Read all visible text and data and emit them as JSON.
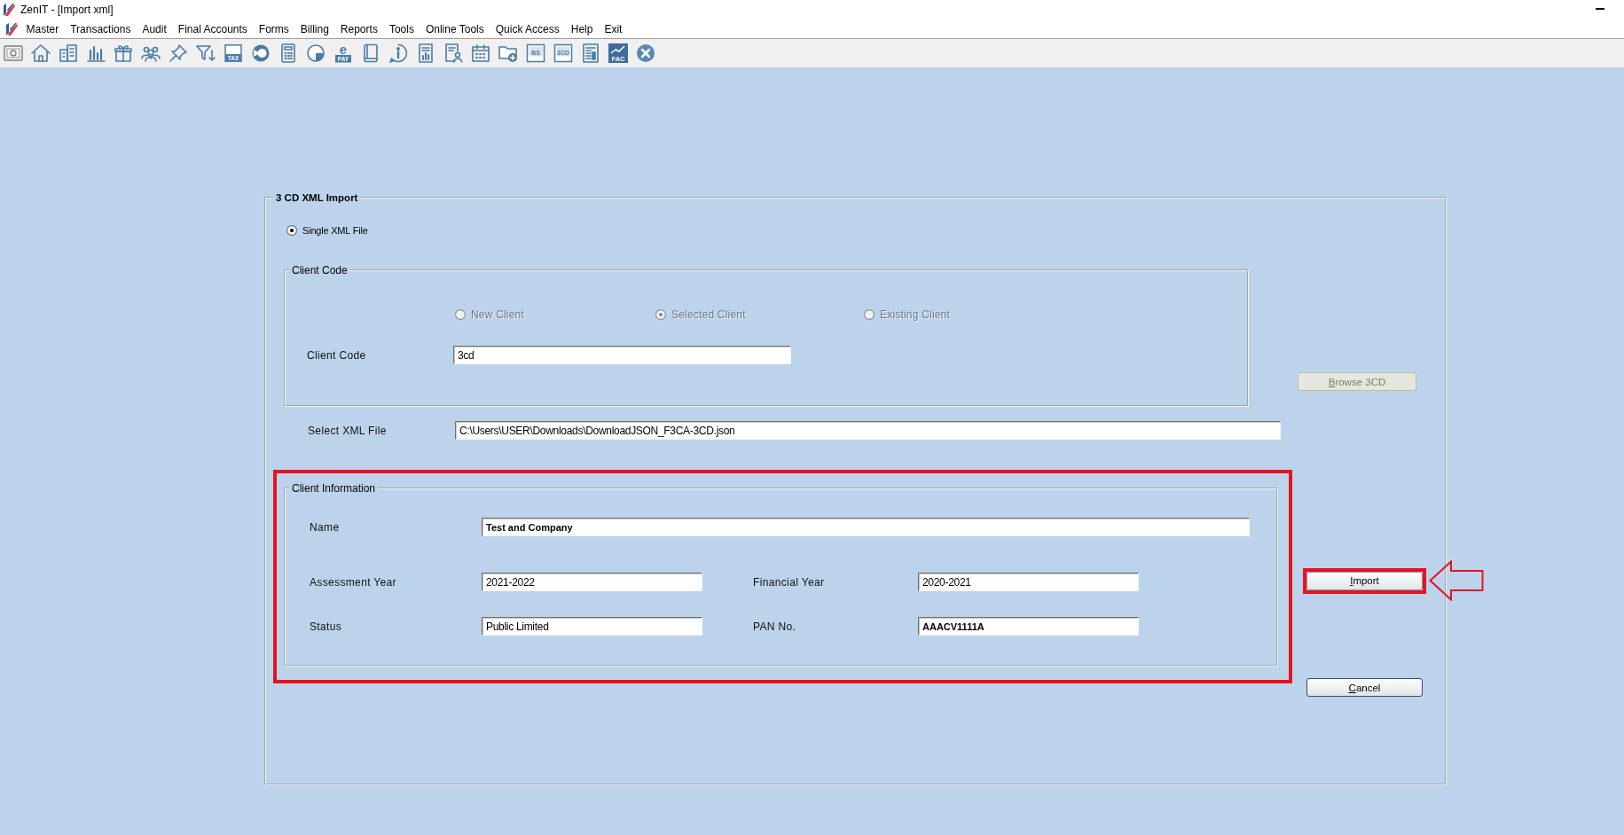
{
  "window": {
    "title": "ZenIT - [Import xml]"
  },
  "menu": [
    "Master",
    "Transactions",
    "Audit",
    "Final Accounts",
    "Forms",
    "Billing",
    "Reports",
    "Tools",
    "Online Tools",
    "Quick Access",
    "Help",
    "Exit"
  ],
  "toolbar": [
    {
      "kind": "note"
    },
    {
      "kind": "home"
    },
    {
      "kind": "buildings"
    },
    {
      "kind": "chart"
    },
    {
      "kind": "gift"
    },
    {
      "kind": "people"
    },
    {
      "kind": "pin"
    },
    {
      "kind": "filter"
    },
    {
      "kind": "tax",
      "caption": "TAX"
    },
    {
      "kind": "disc"
    },
    {
      "kind": "calculator"
    },
    {
      "kind": "pie"
    },
    {
      "kind": "epay",
      "glyph": "e",
      "caption": "PAY"
    },
    {
      "kind": "book"
    },
    {
      "kind": "info"
    },
    {
      "kind": "report"
    },
    {
      "kind": "profile"
    },
    {
      "kind": "calendar"
    },
    {
      "kind": "folder"
    },
    {
      "kind": "tile",
      "caption": "BS"
    },
    {
      "kind": "tile",
      "caption": "3CD"
    },
    {
      "kind": "sheet"
    },
    {
      "kind": "fac",
      "caption": "FAC"
    },
    {
      "kind": "close"
    }
  ],
  "import_dialog": {
    "title": "3 CD XML Import",
    "mode": {
      "label": "Single XML File",
      "selected": true
    },
    "client_code": {
      "title": "Client Code",
      "options": [
        {
          "label": "New Client",
          "selected": false,
          "disabled": true
        },
        {
          "label": "Selected Client",
          "selected": true,
          "disabled": true
        },
        {
          "label": "Existing Client",
          "selected": false,
          "disabled": true
        }
      ],
      "field": {
        "label": "Client Code",
        "value": "3cd"
      }
    },
    "browse_button": {
      "label": "Browse 3CD",
      "disabled": true
    },
    "xml_file": {
      "label": "Select XML File",
      "value": "C:\\Users\\USER\\Downloads\\DownloadJSON_F3CA-3CD.json"
    },
    "client_information": {
      "title": "Client Information",
      "highlighted": true,
      "fields": [
        {
          "kind": "wide",
          "label": "Name",
          "value": "Test and Company",
          "bold": true
        },
        {
          "kind": "half",
          "label": "Assessment Year",
          "value": "2021-2022",
          "bold": false
        },
        {
          "kind": "half",
          "label": "Financial Year",
          "value": "2020-2021",
          "bold": false
        },
        {
          "kind": "half",
          "label": "Status",
          "value": "Public Limited",
          "bold": false
        },
        {
          "kind": "half",
          "label": "PAN No.",
          "value": "AAACV1111A",
          "bold": true
        }
      ]
    },
    "buttons": [
      {
        "label": "Import",
        "highlighted": true,
        "default": false,
        "disabled": false
      },
      {
        "label": "Cancel",
        "highlighted": false,
        "default": true,
        "disabled": false
      }
    ]
  }
}
